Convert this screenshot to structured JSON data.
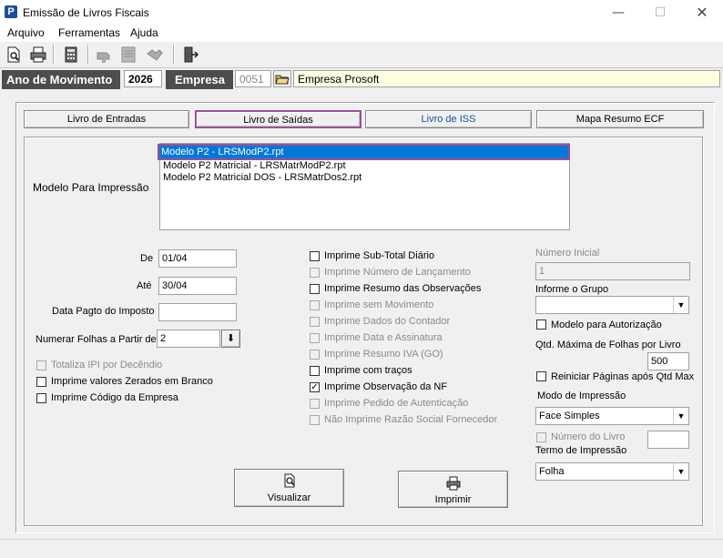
{
  "window": {
    "title": "Emissão de Livros Fiscais",
    "icon_letter": "P",
    "minimize_glyph": "—",
    "maximize_glyph": "☐",
    "close_glyph": "✕"
  },
  "menu": [
    "Arquivo",
    "Ferramentas",
    "Ajuda"
  ],
  "toolbar": {
    "icons": [
      "preview-icon",
      "print-icon",
      "calculator-icon",
      "hand-icon",
      "document-icon",
      "hands-icon",
      "exit-door-icon"
    ]
  },
  "header": {
    "ano_label": "Ano de Movimento",
    "ano_value": "2026",
    "empresa_label": "Empresa",
    "empresa_code": "0051",
    "empresa_name": "Empresa Prosoft"
  },
  "tabs": [
    {
      "label": "Livro de Entradas"
    },
    {
      "label": "Livro de Saídas"
    },
    {
      "label": "Livro de ISS"
    },
    {
      "label": "Mapa Resumo ECF"
    }
  ],
  "modelo": {
    "label": "Modelo Para Impressão",
    "items": [
      "Modelo P2 - LRSModP2.rpt",
      "Modelo P2 Matricial - LRSMatrModP2.rpt",
      "Modelo P2 Matricial DOS - LRSMatrDos2.rpt"
    ],
    "selected_index": 0
  },
  "left": {
    "de_label": "De",
    "de_value": "01/04",
    "ate_label": "Até",
    "ate_value": "30/04",
    "data_pagto_label": "Data Pagto do Imposto",
    "data_pagto_value": "",
    "numerar_label": "Numerar Folhas a Partir de",
    "numerar_value": "2",
    "checks": [
      {
        "label": "Totaliza IPI por Decêndio",
        "checked": false,
        "disabled": true
      },
      {
        "label": "Imprime valores Zerados em Branco",
        "checked": false,
        "disabled": false
      },
      {
        "label": "Imprime Código da Empresa",
        "checked": false,
        "disabled": false
      }
    ]
  },
  "middle_checks": [
    {
      "label": "Imprime Sub-Total Diário",
      "checked": false,
      "disabled": false
    },
    {
      "label": "Imprime Número de Lançamento",
      "checked": false,
      "disabled": true
    },
    {
      "label": "Imprime Resumo das Observações",
      "checked": false,
      "disabled": false
    },
    {
      "label": "Imprime sem Movimento",
      "checked": false,
      "disabled": true
    },
    {
      "label": "Imprime Dados do Contador",
      "checked": false,
      "disabled": true
    },
    {
      "label": "Imprime Data e Assinatura",
      "checked": false,
      "disabled": true
    },
    {
      "label": "Imprime Resumo IVA (GO)",
      "checked": false,
      "disabled": true
    },
    {
      "label": "Imprime com traços",
      "checked": false,
      "disabled": false
    },
    {
      "label": "Imprime Observação da NF",
      "checked": true,
      "disabled": false
    },
    {
      "label": "Imprime Pedido de Autenticação",
      "checked": false,
      "disabled": true
    },
    {
      "label": "Não Imprime Razão Social Fornecedor",
      "checked": false,
      "disabled": true
    }
  ],
  "right": {
    "numero_inicial_label": "Número Inicial",
    "numero_inicial_value": "1",
    "informe_grupo_label": "Informe o Grupo",
    "informe_grupo_value": "",
    "modelo_autorizacao_label": "Modelo para Autorização",
    "qtd_maxima_label": "Qtd. Máxima de Folhas por Livro",
    "qtd_maxima_value": "500",
    "reiniciar_label": "Reiniciar Páginas após Qtd Max",
    "modo_label": "Modo de Impressão",
    "modo_value": "Face Simples",
    "numero_livro_label": "Número do Livro",
    "numero_livro_value": "",
    "termo_label": "Termo de Impressão",
    "termo_value": "Folha"
  },
  "buttons": {
    "visualizar": "Visualizar",
    "imprimir": "Imprimir"
  },
  "colors": {
    "highlight": "#9b4f9b",
    "selection": "#0078d7",
    "header_label_bg": "#4d4d4d",
    "company_name_bg": "#ffffe1",
    "iss_tab_text": "#1a4fa0"
  }
}
